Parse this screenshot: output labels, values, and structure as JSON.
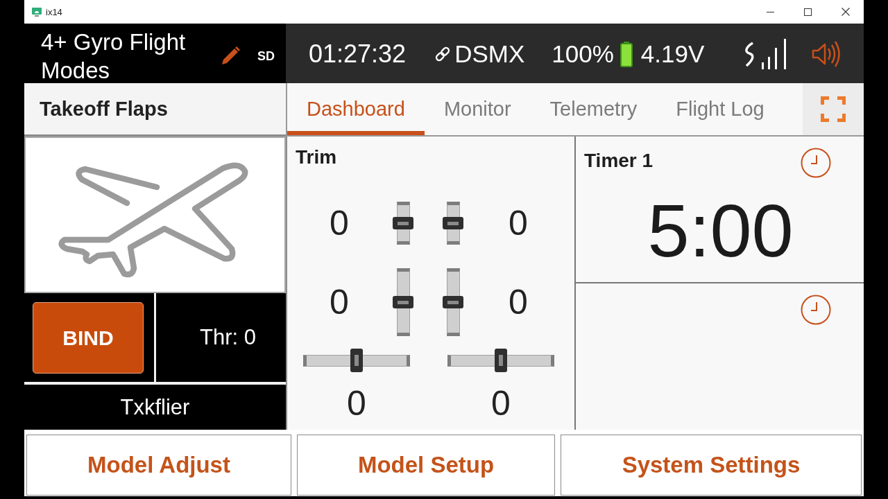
{
  "window": {
    "title": "ix14"
  },
  "header": {
    "model_name": "4+ Gyro Flight Modes",
    "storage": "SD",
    "clock": "01:27:32",
    "protocol": "DSMX",
    "battery_percent": "100%",
    "voltage": "4.19V"
  },
  "flight_mode": "Takeoff Flaps",
  "tabs": [
    {
      "label": "Dashboard",
      "selected": true
    },
    {
      "label": "Monitor",
      "selected": false
    },
    {
      "label": "Telemetry",
      "selected": false
    },
    {
      "label": "Flight Log",
      "selected": false
    }
  ],
  "model": {
    "bind_button": "BIND",
    "throttle": "Thr: 0",
    "user": "Txkflier"
  },
  "trim": {
    "title": "Trim",
    "vertical": [
      {
        "value": "0",
        "level": 0.5
      },
      {
        "value": "0",
        "level": 0.5
      },
      {
        "value": "0",
        "level": 0.5
      },
      {
        "value": "0",
        "level": 0.5
      }
    ],
    "horizontal": [
      {
        "value": "0",
        "level": 0.5
      },
      {
        "value": "0",
        "level": 0.5
      }
    ]
  },
  "timers": [
    {
      "title": "Timer 1",
      "value": "5:00"
    }
  ],
  "menu_buttons": [
    "Model Adjust",
    "Model Setup",
    "System Settings"
  ]
}
